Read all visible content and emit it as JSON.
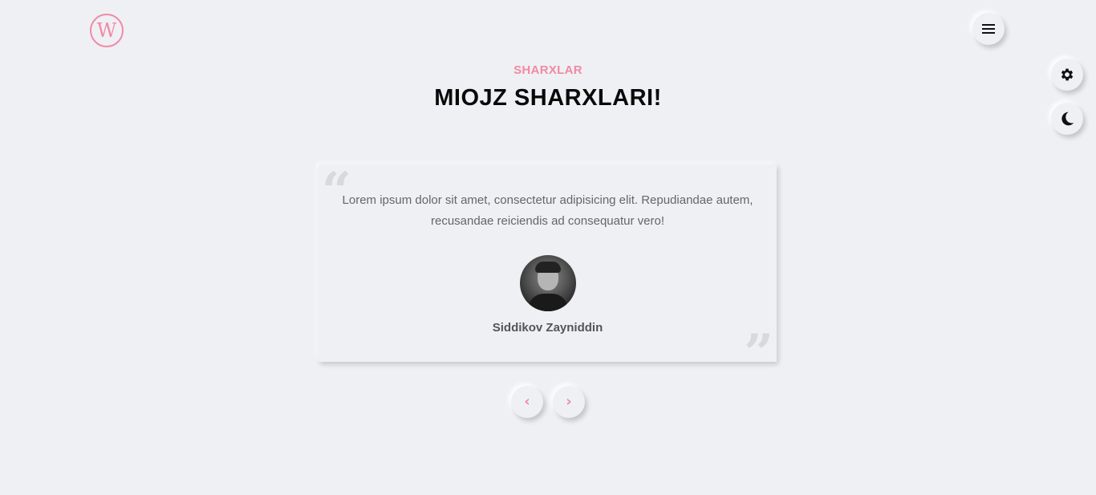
{
  "header": {
    "logo_letter": "W",
    "menu_icon": "hamburger-menu-icon"
  },
  "side_controls": {
    "settings_icon": "gear-icon",
    "theme_icon": "moon-icon"
  },
  "section": {
    "subtitle": "SHARXLAR",
    "title": "MIOJZ SHARXLARI!"
  },
  "testimonial": {
    "text": "Lorem ipsum dolor sit amet, consectetur adipisicing elit. Repudiandae autem, recusandae reiciendis ad consequatur vero!",
    "author": "Siddikov Zayniddin",
    "quote_open": "“",
    "quote_close": "”"
  },
  "navigation": {
    "prev_icon": "‹",
    "next_icon": "›"
  },
  "colors": {
    "accent": "#f08aa5",
    "background": "#eff0f4",
    "title": "#0a0a0a",
    "text": "#666666"
  }
}
